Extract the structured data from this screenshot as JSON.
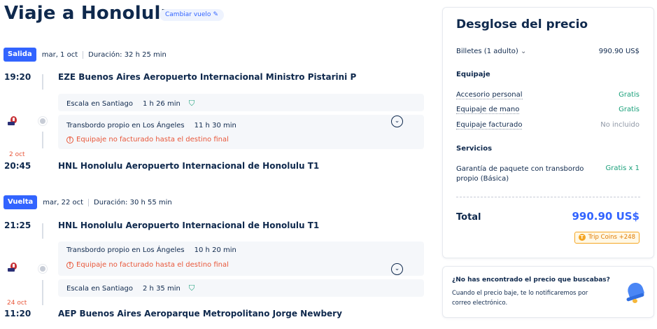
{
  "header": {
    "title": "Viaje a Honolulu",
    "change_flight_label": "Cambiar vuelo",
    "change_flight_icon": "pencil-icon"
  },
  "outbound": {
    "badge": "Salida",
    "date": "mar, 1 oct",
    "duration": "Duración: 32 h 25 min",
    "depart_time": "19:20",
    "depart_airport": "EZE Buenos Aires Aeropuerto Internacional Ministro Pistarini P",
    "stop1": {
      "label": "Escala en Santiago",
      "duration": "1 h 26 min"
    },
    "stop2": {
      "label": "Transbordo propio en Los Ángeles",
      "duration": "11 h 30 min",
      "warning": "Equipaje no facturado hasta el destino final"
    },
    "arrive_note": "2 oct",
    "arrive_time": "20:45",
    "arrive_airport": "HNL Honolulu Aeropuerto Internacional de Honolulu T1"
  },
  "return": {
    "badge": "Vuelta",
    "date": "mar, 22 oct",
    "duration": "Duración: 30 h 55 min",
    "depart_time": "21:25",
    "depart_airport": "HNL Honolulu Aeropuerto Internacional de Honolulu T1",
    "stop1": {
      "label": "Transbordo propio en Los Ángeles",
      "duration": "10 h 20 min",
      "warning": "Equipaje no facturado hasta el destino final"
    },
    "stop2": {
      "label": "Escala en Santiago",
      "duration": "2 h 35 min"
    },
    "arrive_note": "24 oct",
    "arrive_time": "11:20",
    "arrive_airport": "AEP Buenos Aires Aeroparque Metropolitano Jorge Newbery"
  },
  "price": {
    "title": "Desglose del precio",
    "tickets_label": "Billetes (1 adulto)",
    "tickets_value": "990.90 US$",
    "baggage_title": "Equipaje",
    "personal_label": "Accesorio personal",
    "personal_value": "Gratis",
    "hand_label": "Equipaje de mano",
    "hand_value": "Gratis",
    "checked_label": "Equipaje facturado",
    "checked_value": "No incluido",
    "services_title": "Servicios",
    "guarantee_label": "Garantía de paquete con transbordo propio (Básica)",
    "guarantee_value": "Gratis x 1",
    "total_label": "Total",
    "total_value": "990.90 US$",
    "coins_label": "Trip Coins +248"
  },
  "alert": {
    "question": "¿No has encontrado el precio que buscabas?",
    "description": "Cuando el precio baje, te lo notificaremos por correo electrónico."
  },
  "colors": {
    "accent": "#3264ff",
    "warning": "#e8573a",
    "free": "#1aa07a",
    "coins": "#f5a623"
  }
}
